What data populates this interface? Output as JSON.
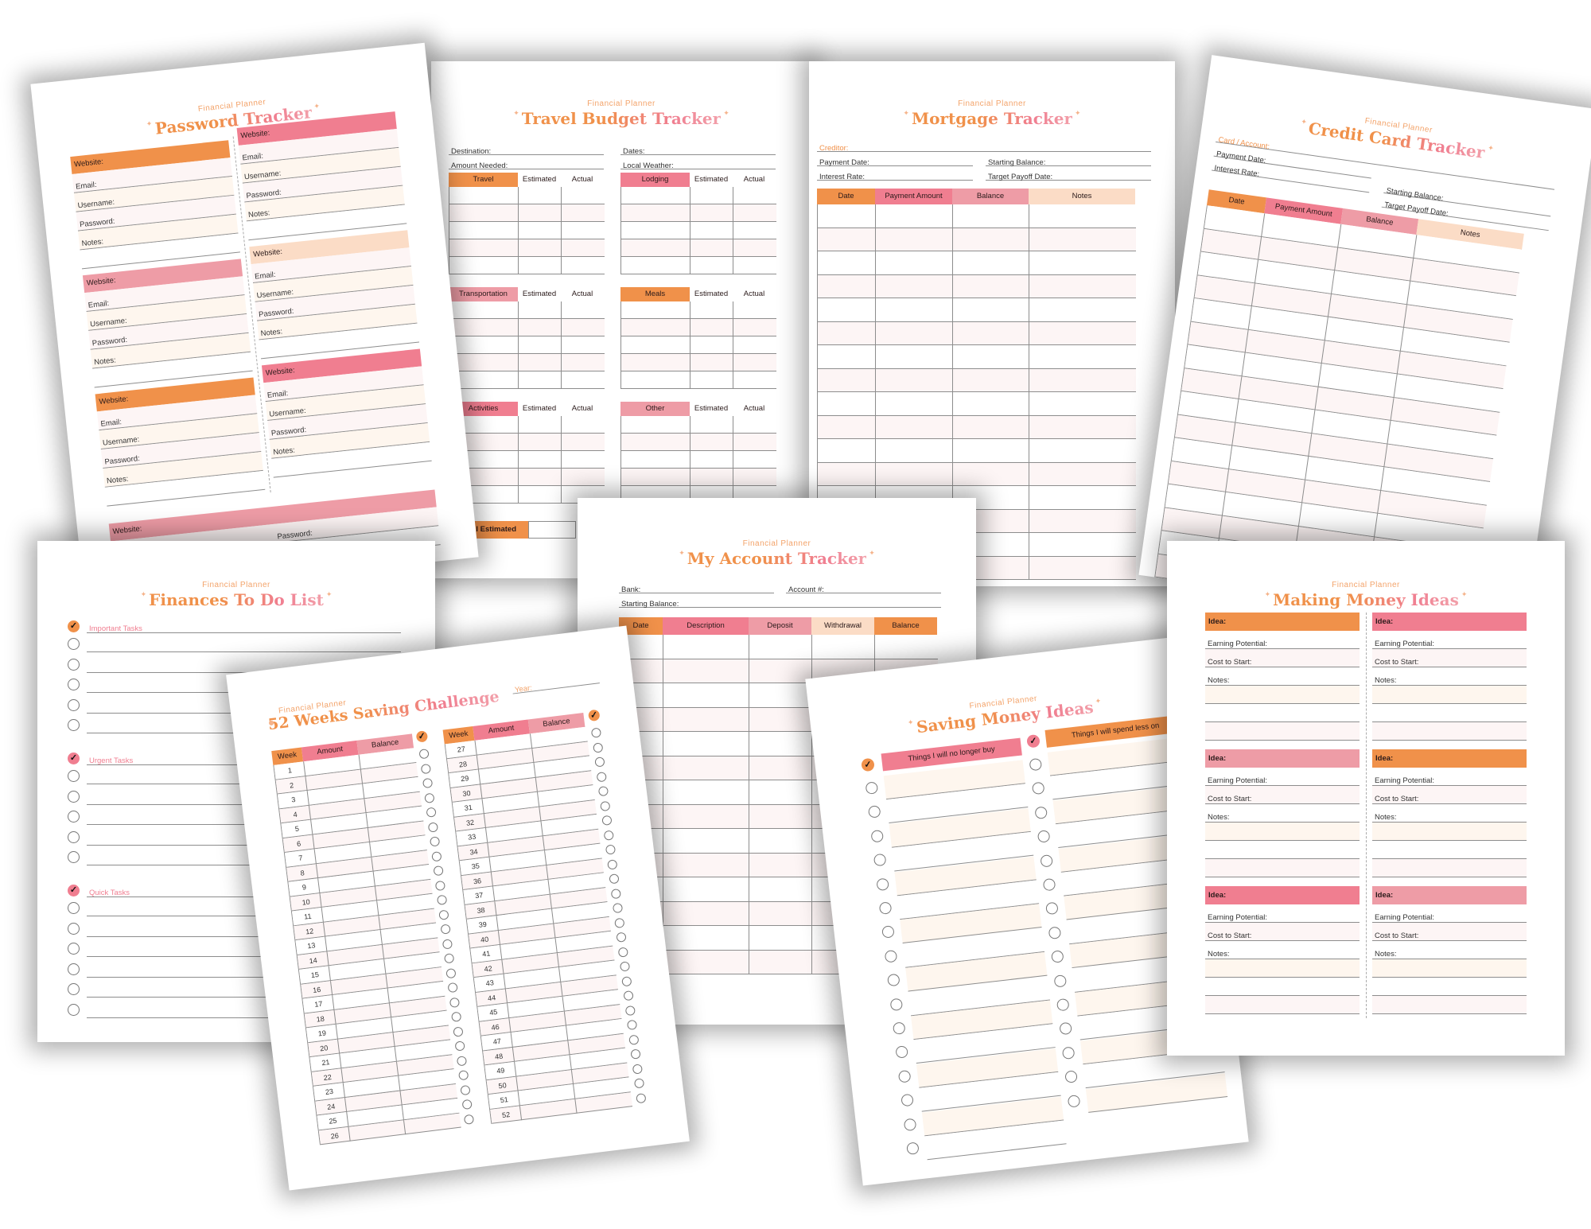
{
  "subtitle": "Financial Planner",
  "colors": {
    "orange": "#F0914A",
    "pink": "#F07E90",
    "light_pink": "#EE9CA6",
    "peach": "#FBDCC6",
    "row_fill_pink": "#FDF5F5",
    "row_fill_peach": "#FEF6EE"
  },
  "pages": {
    "password_tracker": {
      "title": "Password Tracker",
      "fields": {
        "website": "Website:",
        "email": "Email:",
        "username": "Username:",
        "password": "Password:",
        "notes": "Notes:"
      }
    },
    "travel_budget": {
      "title": "Travel Budget Tracker",
      "info": {
        "destination": "Destination:",
        "dates": "Dates:",
        "amount_needed": "Amount Needed:",
        "local_weather": "Local Weather:"
      },
      "categories": [
        "Travel",
        "Lodging",
        "Transportation",
        "Meals",
        "Activities",
        "Other"
      ],
      "col_estimated": "Estimated",
      "col_actual": "Actual",
      "total_label": "Total Estimated"
    },
    "mortgage": {
      "title": "Mortgage Tracker",
      "creditor": "Creditor:",
      "payment_date": "Payment Date:",
      "interest_rate": "Interest Rate:",
      "starting_balance": "Starting Balance:",
      "target_payoff": "Target Payoff Date:",
      "columns": [
        "Date",
        "Payment Amount",
        "Balance",
        "Notes"
      ]
    },
    "credit_card": {
      "title": "Credit Card Tracker",
      "card_account": "Card / Account:",
      "payment_date": "Payment Date:",
      "interest_rate": "Interest Rate:",
      "starting_balance": "Starting Balance:",
      "target_payoff": "Target Payoff Date:",
      "columns": [
        "Date",
        "Payment Amount",
        "Balance",
        "Notes"
      ]
    },
    "todo": {
      "title": "Finances To Do List",
      "sections": [
        "Important Tasks",
        "Urgent Tasks",
        "Quick Tasks"
      ]
    },
    "account": {
      "title": "My Account Tracker",
      "bank": "Bank:",
      "account_no": "Account #:",
      "starting_balance": "Starting Balance:",
      "columns": [
        "Date",
        "Description",
        "Deposit",
        "Withdrawal",
        "Balance"
      ]
    },
    "weeks52": {
      "title": "52 Weeks Saving Challenge",
      "year": "Year:",
      "columns": [
        "Week",
        "Amount",
        "Balance"
      ],
      "weeks": [
        "1",
        "2",
        "3",
        "4",
        "5",
        "6",
        "7",
        "8",
        "9",
        "10",
        "11",
        "12",
        "13",
        "14",
        "15",
        "16",
        "17",
        "18",
        "19",
        "20",
        "21",
        "22",
        "23",
        "24",
        "25",
        "26",
        "27",
        "28",
        "29",
        "30",
        "31",
        "32",
        "33",
        "34",
        "35",
        "36",
        "37",
        "38",
        "39",
        "40",
        "41",
        "42",
        "43",
        "44",
        "45",
        "46",
        "47",
        "48",
        "49",
        "50",
        "51",
        "52"
      ]
    },
    "saving_ideas": {
      "title": "Saving Money Ideas",
      "columns": [
        "Things I will no longer buy",
        "Things I will spend less on"
      ]
    },
    "making_ideas": {
      "title": "Making Money Ideas",
      "idea": "Idea:",
      "earning": "Earning Potential:",
      "cost": "Cost to Start:",
      "notes": "Notes:"
    }
  }
}
